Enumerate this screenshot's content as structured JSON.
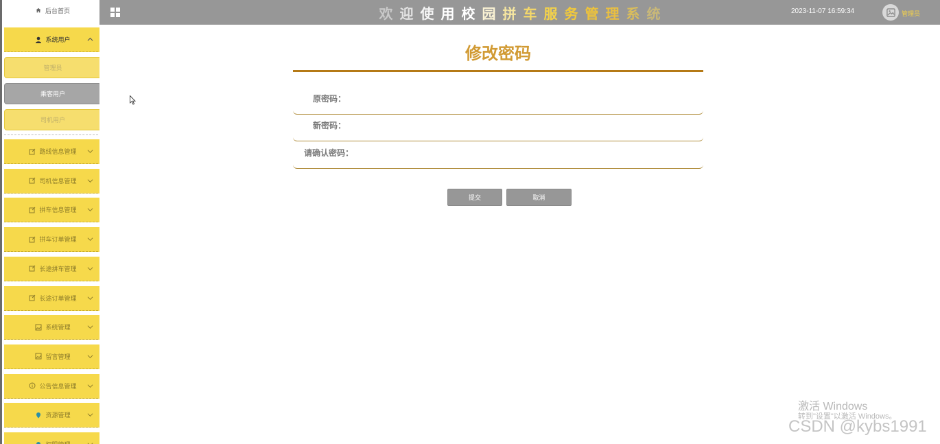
{
  "header": {
    "title_chars": [
      {
        "ch": "欢",
        "color": "#c9c9c9"
      },
      {
        "ch": "迎",
        "color": "#e2e2e2"
      },
      {
        "ch": "使",
        "color": "#f5f5f5"
      },
      {
        "ch": "用",
        "color": "#ffffff"
      },
      {
        "ch": "校",
        "color": "#ffffff"
      },
      {
        "ch": "园",
        "color": "#fbf3d4"
      },
      {
        "ch": "拼",
        "color": "#f6e6a0"
      },
      {
        "ch": "车",
        "color": "#f4d86a"
      },
      {
        "ch": "服",
        "color": "#f4d24a"
      },
      {
        "ch": "务",
        "color": "#f1c93b"
      },
      {
        "ch": "管",
        "color": "#eec33a"
      },
      {
        "ch": "理",
        "color": "#e9bf41"
      },
      {
        "ch": "系",
        "color": "#d9bd5c"
      },
      {
        "ch": "统",
        "color": "#c9b878"
      }
    ],
    "datetime": "2023-11-07 16:59:34",
    "username": "管理员"
  },
  "sidebar": {
    "home_label": "后台首页",
    "system_users": {
      "label": "系统用户",
      "children": [
        "管理员",
        "乘客用户",
        "司机用户"
      ]
    },
    "items": [
      {
        "label": "路线信息管理",
        "icon": "edit-icon"
      },
      {
        "label": "司机信息管理",
        "icon": "edit-icon"
      },
      {
        "label": "拼车信息管理",
        "icon": "edit-icon"
      },
      {
        "label": "拼车订单管理",
        "icon": "edit-icon"
      },
      {
        "label": "长途拼车管理",
        "icon": "edit-icon"
      },
      {
        "label": "长途订单管理",
        "icon": "edit-icon"
      },
      {
        "label": "系统管理",
        "icon": "image-icon"
      },
      {
        "label": "留言管理",
        "icon": "image-icon"
      },
      {
        "label": "公告信息管理",
        "icon": "info-icon"
      },
      {
        "label": "资源管理",
        "icon": "pin-icon"
      },
      {
        "label": "权限管理",
        "icon": "pin-icon"
      }
    ]
  },
  "form": {
    "title": "修改密码",
    "fields": [
      {
        "label": "原密码：",
        "value": ""
      },
      {
        "label": "新密码：",
        "value": ""
      },
      {
        "label": "请确认密码：",
        "value": ""
      }
    ],
    "submit_label": "提交",
    "cancel_label": "取消"
  },
  "watermark": {
    "activate_title": "激活 Windows",
    "activate_hint": "转到\"设置\"以激活 Windows。",
    "csdn": "CSDN @kybs1991"
  },
  "colors": {
    "topbar": "#979797",
    "sidebar_menu": "#f6d94b",
    "title": "#d19a33",
    "title_rule": "#b57a17"
  }
}
